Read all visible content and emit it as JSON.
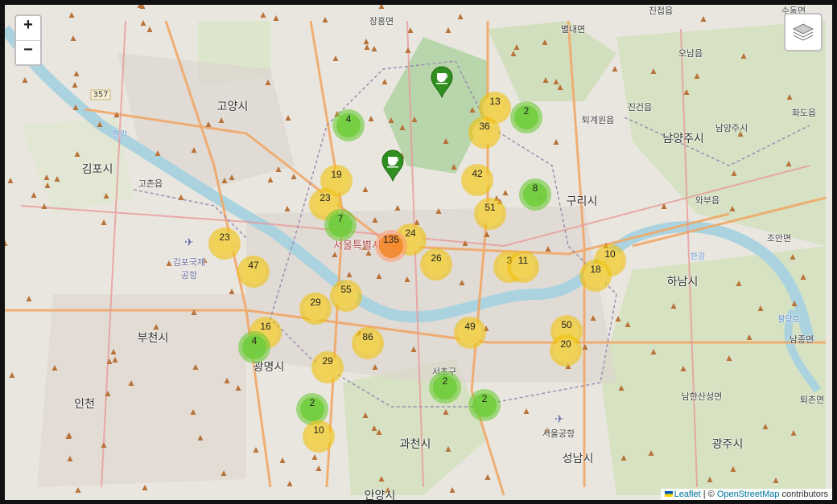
{
  "controls": {
    "zoom_in": "+",
    "zoom_out": "−",
    "layers_icon": "layers-icon"
  },
  "attribution": {
    "leaflet": "Leaflet",
    "separator": " | © ",
    "osm": "OpenStreetMap",
    "suffix": " contributors"
  },
  "colors": {
    "cluster_small": "#6ecc39",
    "cluster_medium": "#f0c20c",
    "cluster_large": "#f18017",
    "marker": "#2f8f1f",
    "water": "#aad3df",
    "forest": "#add19e"
  },
  "places": {
    "goyang": "고양시",
    "gimpo": "김포시",
    "namyangju": "남양주시",
    "guri": "구리시",
    "hanam": "하남시",
    "bucheon": "부천시",
    "gwangmyeong": "광명시",
    "incheon": "인천",
    "gwacheon": "과천시",
    "seongnam": "성남시",
    "gwangju": "광주시",
    "anyang": "안양시",
    "seoul": "서울특별시",
    "jangheung": "장흥면",
    "sudong": "수동면",
    "jinjeop": "진접읍",
    "byeollae": "별내면",
    "oynam": "오남읍",
    "toegyewon": "퇴계원읍",
    "jingeon": "진건읍",
    "hwado": "화도읍",
    "waebu": "와부읍",
    "joan": "조안면",
    "namjong": "남종면",
    "toechon": "퇴촌면",
    "namhansanseong": "남한산성면",
    "gochon": "고촌읍",
    "gimpo_airport": "김포국제\n공항",
    "seoul_airport": "서울공항",
    "seocho": "서초구",
    "han_river": "한강",
    "namyangju_small": "남양주시",
    "paldang": "팔당호",
    "hanam_river": "한강"
  },
  "road_badges": [
    "357"
  ],
  "clusters": [
    {
      "count": "13",
      "size": "medium"
    },
    {
      "count": "2",
      "size": "small"
    },
    {
      "count": "36",
      "size": "medium"
    },
    {
      "count": "4",
      "size": "small"
    },
    {
      "count": "19",
      "size": "medium"
    },
    {
      "count": "42",
      "size": "medium"
    },
    {
      "count": "8",
      "size": "small"
    },
    {
      "count": "23",
      "size": "medium"
    },
    {
      "count": "51",
      "size": "medium"
    },
    {
      "count": "7",
      "size": "small"
    },
    {
      "count": "24",
      "size": "medium"
    },
    {
      "count": "135",
      "size": "large"
    },
    {
      "count": "23",
      "size": "medium"
    },
    {
      "count": "26",
      "size": "medium"
    },
    {
      "count": "3",
      "size": "medium"
    },
    {
      "count": "11",
      "size": "medium"
    },
    {
      "count": "10",
      "size": "medium"
    },
    {
      "count": "47",
      "size": "medium"
    },
    {
      "count": "18",
      "size": "medium"
    },
    {
      "count": "55",
      "size": "medium"
    },
    {
      "count": "29",
      "size": "medium"
    },
    {
      "count": "16",
      "size": "medium"
    },
    {
      "count": "49",
      "size": "medium"
    },
    {
      "count": "50",
      "size": "medium"
    },
    {
      "count": "4",
      "size": "small"
    },
    {
      "count": "86",
      "size": "medium"
    },
    {
      "count": "20",
      "size": "medium"
    },
    {
      "count": "29",
      "size": "medium"
    },
    {
      "count": "2",
      "size": "small"
    },
    {
      "count": "2",
      "size": "small"
    },
    {
      "count": "2",
      "size": "small"
    },
    {
      "count": "10",
      "size": "medium"
    }
  ]
}
